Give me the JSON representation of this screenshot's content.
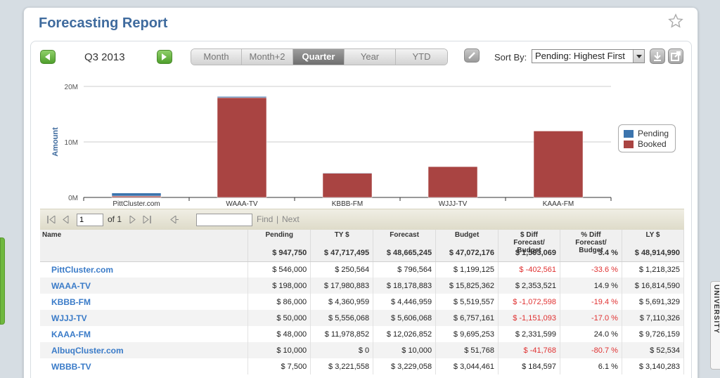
{
  "title": "Forecasting Report",
  "period": "Q3 2013",
  "tabs": [
    "Month",
    "Month+2",
    "Quarter",
    "Year",
    "YTD"
  ],
  "active_tab": "Quarter",
  "sort": {
    "label": "Sort By:",
    "value": "Pending: Highest First"
  },
  "side_tab_text": "UNIVERSITY",
  "chart_data": {
    "type": "bar",
    "ylabel": "Amount",
    "xlabel": "",
    "yticks": [
      "0M",
      "10M",
      "20M"
    ],
    "ylim": [
      0,
      20000000
    ],
    "categories": [
      "PittCluster.com",
      "WAAA-TV",
      "KBBB-FM",
      "WJJJ-TV",
      "KAAA-FM"
    ],
    "series": [
      {
        "name": "Pending",
        "color": "#3b74ad",
        "values": [
          546000,
          198000,
          86000,
          50000,
          48000
        ]
      },
      {
        "name": "Booked",
        "color": "#a94442",
        "values": [
          250564,
          17980883,
          4360959,
          5556068,
          11978852
        ]
      }
    ],
    "legend_position": "right",
    "grid": true
  },
  "pager": {
    "page": "1",
    "of": "of 1",
    "find": "Find",
    "next": "Next",
    "sep": "|"
  },
  "table": {
    "headers": [
      {
        "label": "Name",
        "total": ""
      },
      {
        "label": "Pending",
        "total": "$ 947,750"
      },
      {
        "label": "TY $",
        "total": "$ 47,717,495"
      },
      {
        "label": "Forecast",
        "total": "$ 48,665,245"
      },
      {
        "label": "Budget",
        "total": "$ 47,072,176"
      },
      {
        "label": "$ Diff\nForecast/ Budget",
        "total": "$ 1,593,069"
      },
      {
        "label": "% Diff\nForecast/ Budget",
        "total": "3.4 %"
      },
      {
        "label": "LY $",
        "total": "$ 48,914,990"
      }
    ],
    "rows": [
      [
        "PittCluster.com",
        "$ 546,000",
        "$ 250,564",
        "$ 796,564",
        "$ 1,199,125",
        "$ -402,561",
        "-33.6 %",
        "$ 1,218,325"
      ],
      [
        "WAAA-TV",
        "$ 198,000",
        "$ 17,980,883",
        "$ 18,178,883",
        "$ 15,825,362",
        "$ 2,353,521",
        "14.9 %",
        "$ 16,814,590"
      ],
      [
        "KBBB-FM",
        "$ 86,000",
        "$ 4,360,959",
        "$ 4,446,959",
        "$ 5,519,557",
        "$ -1,072,598",
        "-19.4 %",
        "$ 5,691,329"
      ],
      [
        "WJJJ-TV",
        "$ 50,000",
        "$ 5,556,068",
        "$ 5,606,068",
        "$ 6,757,161",
        "$ -1,151,093",
        "-17.0 %",
        "$ 7,110,326"
      ],
      [
        "KAAA-FM",
        "$ 48,000",
        "$ 11,978,852",
        "$ 12,026,852",
        "$ 9,695,253",
        "$ 2,331,599",
        "24.0 %",
        "$ 9,726,159"
      ],
      [
        "AlbuqCluster.com",
        "$ 10,000",
        "$ 0",
        "$ 10,000",
        "$ 51,768",
        "$ -41,768",
        "-80.7 %",
        "$ 52,534"
      ],
      [
        "WBBB-TV",
        "$ 7,500",
        "$ 3,221,558",
        "$ 3,229,058",
        "$ 3,044,461",
        "$ 184,597",
        "6.1 %",
        "$ 3,140,283"
      ]
    ]
  }
}
